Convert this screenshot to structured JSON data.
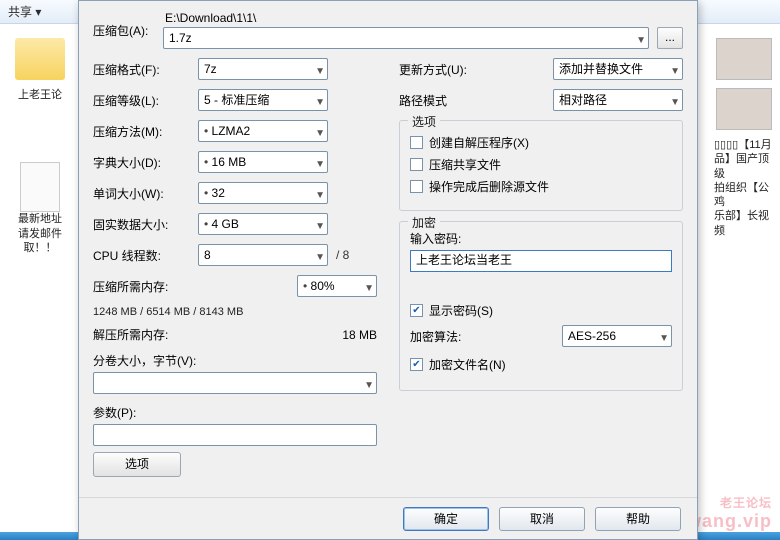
{
  "topbar": {
    "share": "共享 ▾"
  },
  "bg_icons": {
    "folder1_label": "上老王论",
    "folder2_label": "最新地址\n请发邮件\n取！！",
    "right_label": "▯▯▯▯【11月\n品】国产顶级\n拍组织【公鸡\n乐部】长视频"
  },
  "archive": {
    "label": "压缩包(A):",
    "path": "E:\\Download\\1\\1\\",
    "filename": "1.7z",
    "browse": "..."
  },
  "left": {
    "format_label": "压缩格式(F):",
    "format": "7z",
    "level_label": "压缩等级(L):",
    "level": "5 - 标准压缩",
    "method_label": "压缩方法(M):",
    "method": "LZMA2",
    "method_dirty": true,
    "dict_label": "字典大小(D):",
    "dict": "16 MB",
    "dict_dirty": true,
    "word_label": "单词大小(W):",
    "word": "32",
    "word_dirty": true,
    "solid_label": "固实数据大小:",
    "solid": "4 GB",
    "solid_dirty": true,
    "threads_label": "CPU 线程数:",
    "threads": "8",
    "threads_total": "/ 8",
    "mem_comp_label": "压缩所需内存:",
    "mem_comp_pct": "80%",
    "mem_comp_pct_dirty": true,
    "mem_comp_detail": "1248 MB / 6514 MB / 8143 MB",
    "mem_decomp_label": "解压所需内存:",
    "mem_decomp": "18 MB",
    "split_label": "分卷大小，字节(V):",
    "split_value": "",
    "params_label": "参数(P):",
    "params_value": "",
    "options_btn": "选项"
  },
  "right": {
    "update_label": "更新方式(U):",
    "update": "添加并替换文件",
    "pathmode_label": "路径模式",
    "pathmode": "相对路径",
    "options_legend": "选项",
    "opt_sfx": "创建自解压程序(X)",
    "opt_sfx_checked": false,
    "opt_shared": "压缩共享文件",
    "opt_shared_checked": false,
    "opt_delete": "操作完成后删除源文件",
    "opt_delete_checked": false,
    "enc_legend": "加密",
    "pw_label": "输入密码:",
    "pw_value": "上老王论坛当老王",
    "show_pw": "显示密码(S)",
    "show_pw_checked": true,
    "enc_method_label": "加密算法:",
    "enc_method": "AES-256",
    "enc_names": "加密文件名(N)",
    "enc_names_checked": true
  },
  "footer": {
    "ok": "确定",
    "cancel": "取消",
    "help": "帮助"
  },
  "watermark": {
    "line1": "老王论坛",
    "line2": "laowang.vip"
  }
}
